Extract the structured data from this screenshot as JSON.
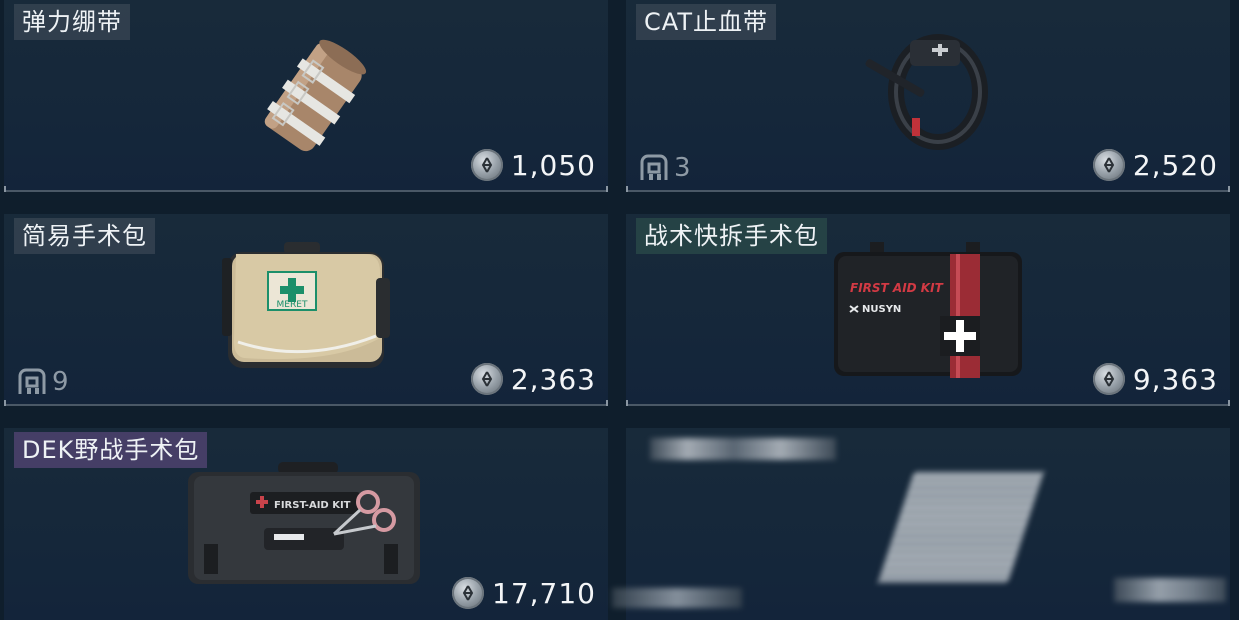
{
  "items": [
    {
      "name": "弹力绷带",
      "price": "1,050",
      "slots": null
    },
    {
      "name": "CAT止血带",
      "price": "2,520",
      "slots": "3"
    },
    {
      "name": "简易手术包",
      "price": "2,363",
      "slots": "9"
    },
    {
      "name": "战术快拆手术包",
      "price": "9,363",
      "slots": null
    },
    {
      "name": "DEK野战手术包",
      "price": "17,710",
      "slots": null
    }
  ],
  "graphics": {
    "bag1_label": "MERET",
    "bag2_title": "FIRST AID KIT",
    "bag2_brand": "NUSYN",
    "roll_label": "FIRST-AID KIT"
  },
  "colors": {
    "background": "#0f1e2c",
    "card": "#172a3b",
    "name_tag": "#464f5c",
    "name_tag_teal": "#284648",
    "name_tag_purple": "#4e426e",
    "price_text": "#f3f5f7",
    "slot_text": "#8e9aa5"
  }
}
